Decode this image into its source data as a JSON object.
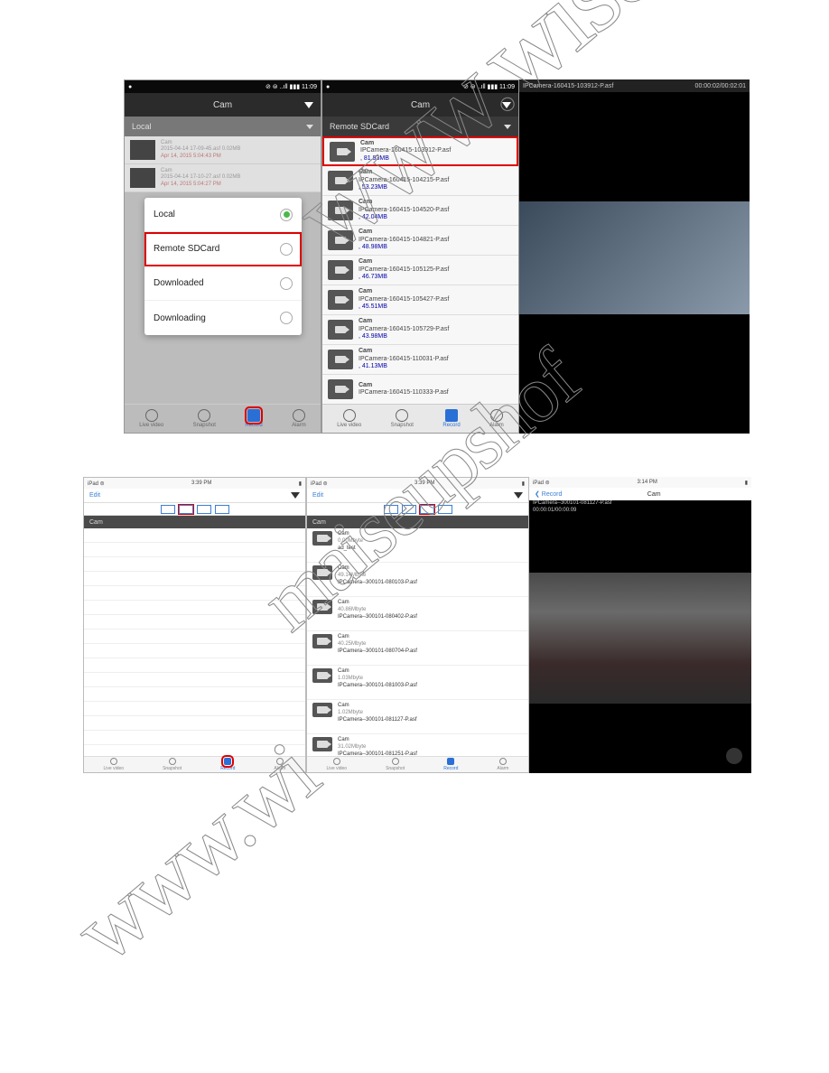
{
  "row1": {
    "phone1": {
      "status_left": "●",
      "status_right": "⊘ ⊜ ..ıll ▮▮▮ 11:09",
      "title": "Cam",
      "dropdown": "Local",
      "dim_items": [
        {
          "name": "Cam",
          "file": "2015-04-14 17-09-45.asf 0.02MB",
          "date": "Apr 14, 2015 5:04:43 PM"
        },
        {
          "name": "Cam",
          "file": "2015-04-14 17-10-27.asf 0.02MB",
          "date": "Apr 14, 2015 5:04:27 PM"
        }
      ],
      "modal": [
        {
          "label": "Local",
          "on": true,
          "sel": false
        },
        {
          "label": "Remote SDCard",
          "on": false,
          "sel": true
        },
        {
          "label": "Downloaded",
          "on": false,
          "sel": false
        },
        {
          "label": "Downloading",
          "on": false,
          "sel": false
        }
      ],
      "tabs": [
        "Live video",
        "Snapshot",
        "Record",
        "Alarm"
      ]
    },
    "phone2": {
      "status_left": "●",
      "status_right": "⊘ ⊜ ..ıll ▮▮▮ 11:09",
      "title": "Cam",
      "dropdown": "Remote SDCard",
      "items": [
        {
          "name": "Cam",
          "file": "IPCamera-160415-103912-P.asf",
          "size": ", 81.93MB",
          "sel": true
        },
        {
          "name": "Cam",
          "file": "IPCamera-160415-104215-P.asf",
          "size": ", 53.23MB"
        },
        {
          "name": "Cam",
          "file": "IPCamera-160415-104520-P.asf",
          "size": ", 42.04MB"
        },
        {
          "name": "Cam",
          "file": "IPCamera-160415-104821-P.asf",
          "size": ", 48.98MB"
        },
        {
          "name": "Cam",
          "file": "IPCamera-160415-105125-P.asf",
          "size": ", 46.73MB"
        },
        {
          "name": "Cam",
          "file": "IPCamera-160415-105427-P.asf",
          "size": ", 45.51MB"
        },
        {
          "name": "Cam",
          "file": "IPCamera-160415-105729-P.asf",
          "size": ", 43.98MB"
        },
        {
          "name": "Cam",
          "file": "IPCamera-160415-110031-P.asf",
          "size": ", 41.13MB"
        },
        {
          "name": "Cam",
          "file": "IPCamera-160415-110333-P.asf",
          "size": ""
        }
      ],
      "tabs": [
        "Live video",
        "Snapshot",
        "Record",
        "Alarm"
      ]
    },
    "player": {
      "filename": "IPCamera-160415-103912-P.asf",
      "timecode": "00:00:02/00:02:01"
    }
  },
  "row2": {
    "tablet1": {
      "status_left": "iPad ⊜",
      "status_center": "3:39 PM",
      "status_right": "▮",
      "back": "Edit",
      "drop": "Cam",
      "tabs": [
        "Live video",
        "Snapshot",
        "Record",
        "Alarm"
      ],
      "tool_sel_idx": 1
    },
    "tablet2": {
      "status_left": "iPad ⊜",
      "status_center": "3:39 PM",
      "status_right": "▮",
      "back": "Edit",
      "drop": "Cam",
      "tool_sel_idx": 2,
      "items": [
        {
          "name": "Cam",
          "size": "0.00Mbyte",
          "file": "ad_test"
        },
        {
          "name": "Cam",
          "size": "49.14Mbyte",
          "file": "IPCamera--300101-080103-P.asf"
        },
        {
          "name": "Cam",
          "size": "40.86Mbyte",
          "file": "IPCamera--300101-080402-P.asf"
        },
        {
          "name": "Cam",
          "size": "40.25Mbyte",
          "file": "IPCamera--300101-080704-P.asf"
        },
        {
          "name": "Cam",
          "size": "1.03Mbyte",
          "file": "IPCamera--300101-081003-P.asf"
        },
        {
          "name": "Cam",
          "size": "1.02Mbyte",
          "file": "IPCamera--300101-081127-P.asf"
        },
        {
          "name": "Cam",
          "size": "31.02Mbyte",
          "file": "IPCamera--300101-081251-P.asf"
        }
      ],
      "tabs": [
        "Live video",
        "Snapshot",
        "Record",
        "Alarm"
      ]
    },
    "player": {
      "status_left": "iPad ⊜",
      "status_center": "3:14 PM",
      "status_right": "▮",
      "back": "❮ Record",
      "title": "Cam",
      "filename": "IPCamera--300101-081127-P.asf",
      "timecode": "00:00:01/00:00:09"
    }
  },
  "watermarks": [
    "www.wiseupshop.com",
    "maiseupshof",
    "www.wi"
  ]
}
